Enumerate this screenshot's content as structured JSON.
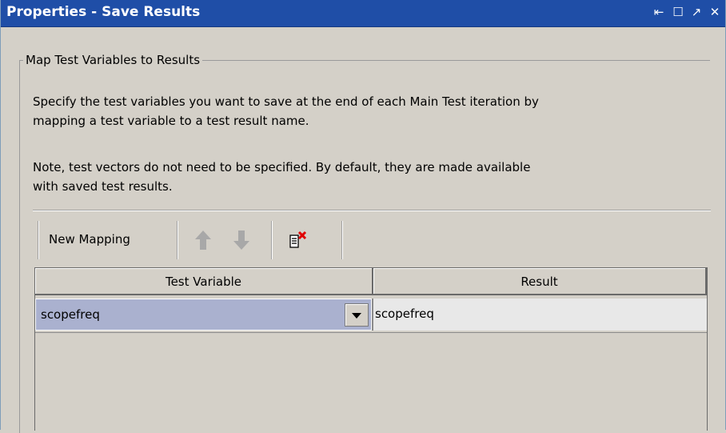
{
  "window": {
    "title": "Properties - Save Results",
    "controls": [
      {
        "name": "pin-icon",
        "glyph": "⇤"
      },
      {
        "name": "maximize-icon",
        "glyph": "☐"
      },
      {
        "name": "restore-icon",
        "glyph": "↗"
      },
      {
        "name": "close-icon",
        "glyph": "✕"
      }
    ]
  },
  "group": {
    "title": "Map Test Variables to Results",
    "description_1_line1": "Specify the test variables you want to save at the end of each Main Test iteration by",
    "description_1_line2": "mapping a test variable to a test result name.",
    "description_2_line1": "Note, test vectors do not need to be specified. By default, they are made available",
    "description_2_line2": "with saved test results."
  },
  "toolbar": {
    "new_mapping_label": "New Mapping",
    "icons": [
      "move-up-icon",
      "move-down-icon",
      "delete-mapping-icon"
    ]
  },
  "table": {
    "columns": [
      "Test Variable",
      "Result"
    ],
    "rows": [
      {
        "test_variable": "scopefreq",
        "result": "scopefreq"
      }
    ]
  },
  "colors": {
    "titlebar": "#1f4ea7",
    "panel": "#d4d0c8",
    "selected_cell": "#aab1cf",
    "result_cell": "#e8e8e8"
  }
}
